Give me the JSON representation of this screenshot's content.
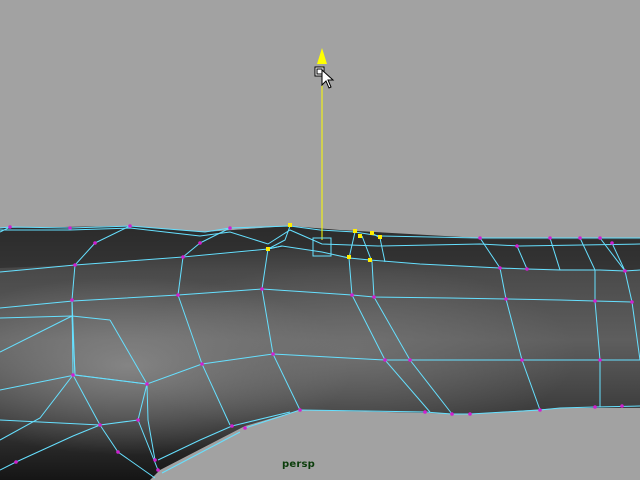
{
  "viewport": {
    "camera_label": "persp",
    "background_color": "#a2a2a2",
    "wireframe_color": "#66e0ff",
    "vertex_color": "#d020d0",
    "selected_vertex_color": "#ffee00",
    "manipulator_color": "#ffff00"
  },
  "manipulator": {
    "type": "move-y-axis",
    "icon": "move-handle-icon"
  },
  "cursor": {
    "icon": "arrow-cursor-icon"
  }
}
